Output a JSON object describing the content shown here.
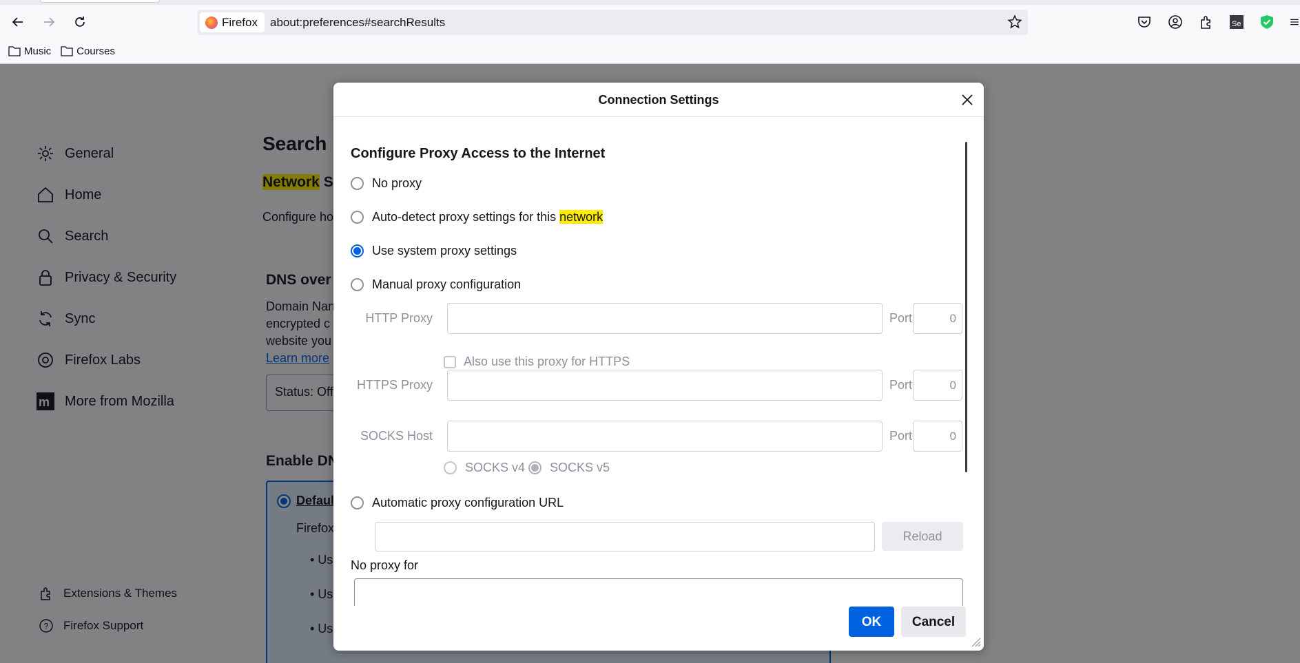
{
  "browser": {
    "identity_label": "Firefox",
    "url": "about:preferences#searchResults",
    "bookmarks": [
      "Music",
      "Courses"
    ],
    "toolbar_icons": [
      "back-icon",
      "forward-icon",
      "reload-icon",
      "pocket-icon",
      "account-icon",
      "extensions-icon",
      "selenium-icon",
      "shield-check-icon"
    ]
  },
  "sidebar": {
    "items": [
      {
        "label": "General",
        "icon": "gear-icon"
      },
      {
        "label": "Home",
        "icon": "home-icon"
      },
      {
        "label": "Search",
        "icon": "search-icon"
      },
      {
        "label": "Privacy & Security",
        "icon": "lock-icon"
      },
      {
        "label": "Sync",
        "icon": "sync-icon"
      },
      {
        "label": "Firefox Labs",
        "icon": "labs-icon"
      },
      {
        "label": "More from Mozilla",
        "icon": "mozilla-icon"
      }
    ],
    "bottom_items": [
      {
        "label": "Extensions & Themes",
        "icon": "puzzle-icon"
      },
      {
        "label": "Firefox Support",
        "icon": "help-icon"
      }
    ]
  },
  "prefs": {
    "search_title": "Search R",
    "network_highlight": "Network",
    "network_rest": " S",
    "configure_text": "Configure ho",
    "dns_title": "DNS over",
    "dns_desc_lines": [
      "Domain Nan",
      "encrypted c",
      "website you"
    ],
    "learn_more": "Learn more",
    "status": "Status: Off",
    "enable_title": "Enable DN",
    "default_label": "Defaul",
    "default_sub": "Firefox",
    "bullets": [
      "• Use",
      "• Use",
      "• Use"
    ]
  },
  "dialog": {
    "title": "Connection Settings",
    "section_title": "Configure Proxy Access to the Internet",
    "options": {
      "no_proxy": "No proxy",
      "auto_detect_prefix": "Auto-detect proxy settings for this ",
      "auto_detect_highlight": "network",
      "system": "Use system proxy settings",
      "manual": "Manual proxy configuration",
      "auto_url": "Automatic proxy configuration URL"
    },
    "selected_option": "system",
    "fields": {
      "http_label": "HTTP Proxy",
      "https_label": "HTTPS Proxy",
      "socks_label": "SOCKS Host",
      "port_label": "Port",
      "http_port": "0",
      "https_port": "0",
      "socks_port": "0",
      "also_https": "Also use this proxy for HTTPS",
      "socks_v4": "SOCKS v4",
      "socks_v5": "SOCKS v5"
    },
    "reload": "Reload",
    "no_proxy_for": "No proxy for",
    "ok": "OK",
    "cancel": "Cancel"
  }
}
